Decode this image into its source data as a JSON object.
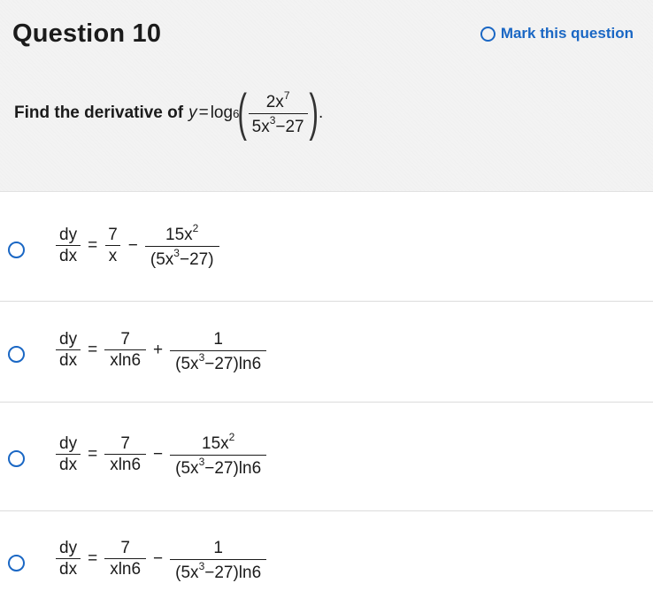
{
  "question": {
    "title": "Question 10",
    "mark_label": "Mark this question",
    "prompt_text": "Find the derivative of",
    "function": {
      "lhs": "y",
      "eq": "=",
      "log": "log",
      "base": "6",
      "numerator": "2x",
      "numerator_exp": "7",
      "denominator_a": "5x",
      "denominator_exp": "3",
      "denominator_b": "−27",
      "period": "."
    }
  },
  "options": [
    {
      "dy": "dy",
      "dx": "dx",
      "eq": "=",
      "t1_num": "7",
      "t1_den": "x",
      "op": "−",
      "t2_num": "15x",
      "t2_num_exp": "2",
      "t2_den_a": "(5x",
      "t2_den_exp": "3",
      "t2_den_b": "−27)"
    },
    {
      "dy": "dy",
      "dx": "dx",
      "eq": "=",
      "t1_num": "7",
      "t1_den": "xln6",
      "op": "+",
      "t2_num": "1",
      "t2_num_exp": "",
      "t2_den_a": "(5x",
      "t2_den_exp": "3",
      "t2_den_b": "−27)ln6"
    },
    {
      "dy": "dy",
      "dx": "dx",
      "eq": "=",
      "t1_num": "7",
      "t1_den": "xln6",
      "op": "−",
      "t2_num": "15x",
      "t2_num_exp": "2",
      "t2_den_a": "(5x",
      "t2_den_exp": "3",
      "t2_den_b": "−27)ln6"
    },
    {
      "dy": "dy",
      "dx": "dx",
      "eq": "=",
      "t1_num": "7",
      "t1_den": "xln6",
      "op": "−",
      "t2_num": "1",
      "t2_num_exp": "",
      "t2_den_a": "(5x",
      "t2_den_exp": "3",
      "t2_den_b": "−27)ln6"
    }
  ],
  "colors": {
    "accent": "#1a67c4",
    "header_bg": "#f3f3f3"
  }
}
